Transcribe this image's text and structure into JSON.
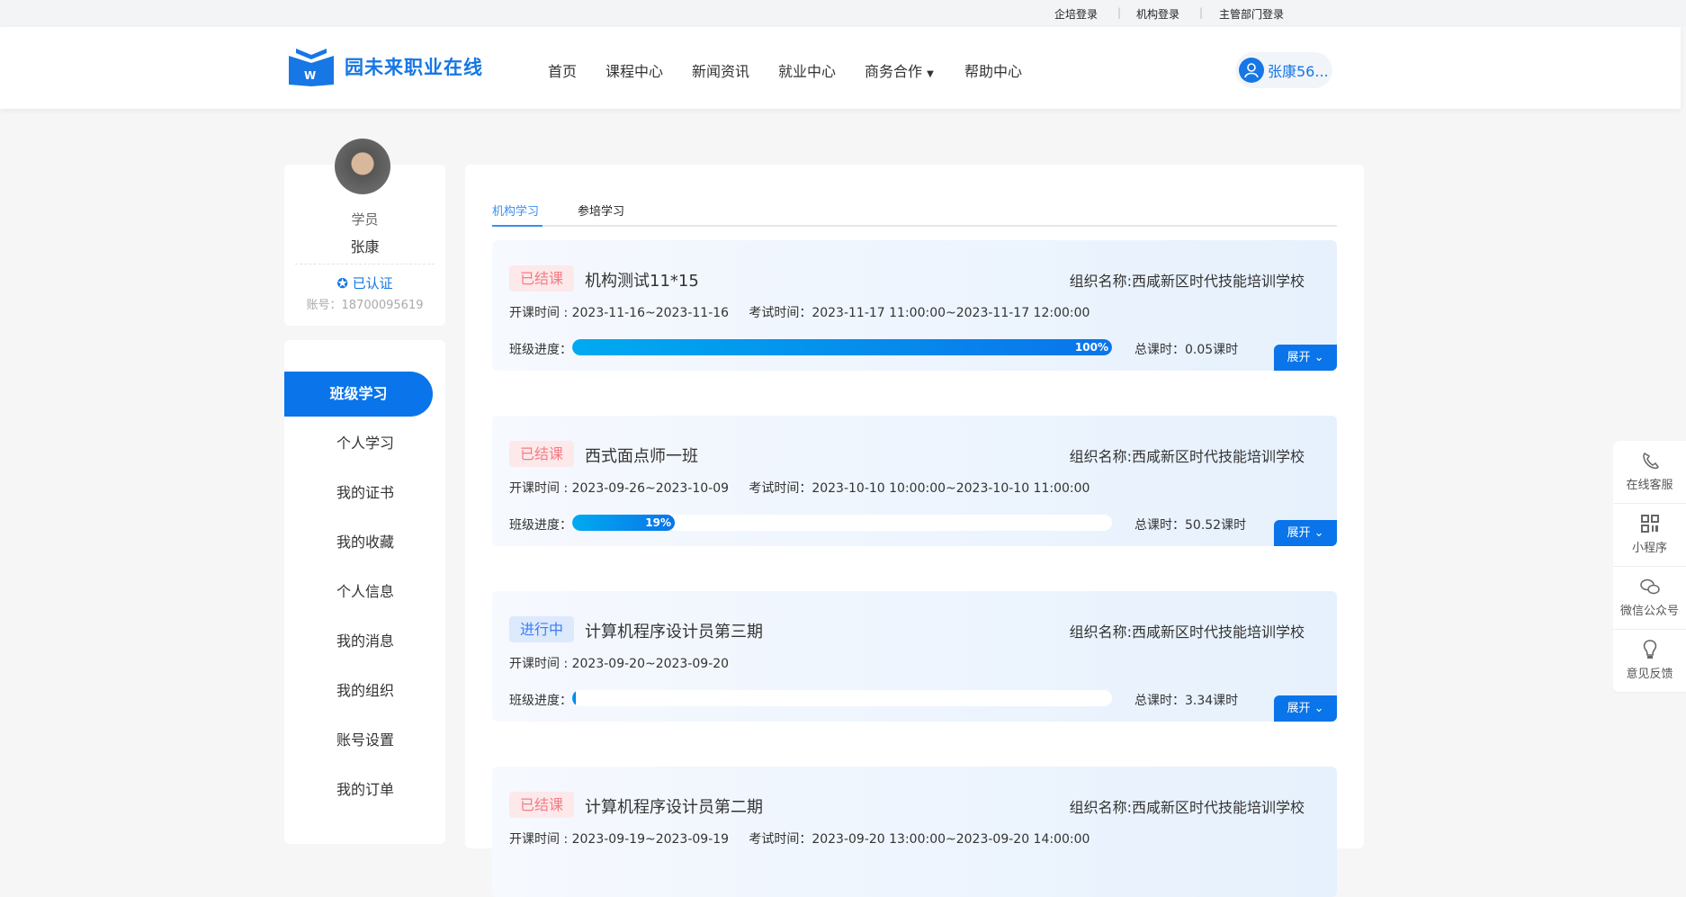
{
  "topbar": {
    "links": [
      "企培登录",
      "机构登录",
      "主管部门登录"
    ]
  },
  "header": {
    "logo_text": "园未来职业在线",
    "nav": [
      "首页",
      "课程中心",
      "新闻资讯",
      "就业中心",
      "商务合作",
      "帮助中心"
    ],
    "user": "张康56..."
  },
  "profile": {
    "role": "学员",
    "name": "张康",
    "verified": "已认证",
    "account": "账号：18700095619"
  },
  "sidebar": {
    "items": [
      "班级学习",
      "个人学习",
      "我的证书",
      "我的收藏",
      "个人信息",
      "我的消息",
      "我的组织",
      "账号设置",
      "我的订单"
    ],
    "active": "班级学习"
  },
  "tabs": [
    "机构学习",
    "参培学习"
  ],
  "courses": [
    {
      "status": "已结课",
      "status_type": "done",
      "title": "机构测试11*15",
      "org": "组织名称:西咸新区时代技能培训学校",
      "dates": "开课时间 : 2023-11-16~2023-11-16     考试时间：2023-11-17 11:00:00~2023-11-17 12:00:00",
      "progress_label": "班级进度：",
      "progress": 100,
      "progress_text": "100%",
      "hours": "总课时：0.05课时",
      "expand": "展开"
    },
    {
      "status": "已结课",
      "status_type": "done",
      "title": "西式面点师一班",
      "org": "组织名称:西咸新区时代技能培训学校",
      "dates": "开课时间 : 2023-09-26~2023-10-09     考试时间：2023-10-10 10:00:00~2023-10-10 11:00:00",
      "progress_label": "班级进度：",
      "progress": 19,
      "progress_text": "19%",
      "hours": "总课时：50.52课时",
      "expand": "展开"
    },
    {
      "status": "进行中",
      "status_type": "ing",
      "title": "计算机程序设计员第三期",
      "org": "组织名称:西咸新区时代技能培训学校",
      "dates": "开课时间 : 2023-09-20~2023-09-20",
      "progress_label": "班级进度：",
      "progress": 0,
      "progress_text": "",
      "hours": "总课时：3.34课时",
      "expand": "展开"
    },
    {
      "status": "已结课",
      "status_type": "done",
      "title": "计算机程序设计员第二期",
      "org": "组织名称:西咸新区时代技能培训学校",
      "dates": "开课时间 : 2023-09-19~2023-09-19     考试时间：2023-09-20 13:00:00~2023-09-20 14:00:00",
      "progress_label": "班级进度：",
      "progress": null,
      "progress_text": "",
      "hours": "",
      "expand": ""
    }
  ],
  "float_panel": [
    {
      "label": "在线客服",
      "icon": "phone-icon"
    },
    {
      "label": "小程序",
      "icon": "qrcode-icon"
    },
    {
      "label": "微信公众号",
      "icon": "wechat-icon"
    },
    {
      "label": "意见反馈",
      "icon": "lightbulb-icon"
    }
  ],
  "colors": {
    "accent": "#0a74ea",
    "done_badge": "#f37c84",
    "ing_badge": "#3a7ef0"
  }
}
